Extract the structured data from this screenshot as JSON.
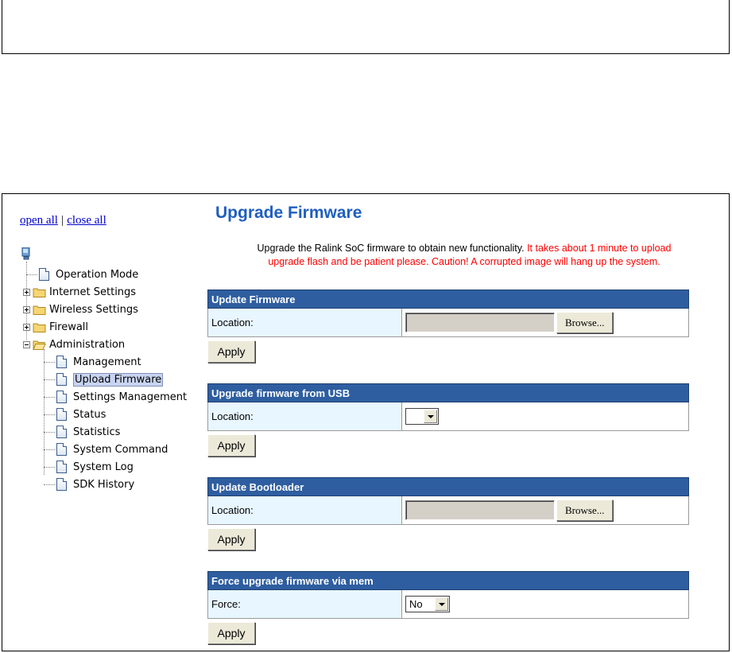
{
  "nav": {
    "open_all": "open all",
    "separator": "|",
    "close_all": "close all",
    "items": [
      {
        "label": "Operation Mode",
        "type": "doc"
      },
      {
        "label": "Internet Settings",
        "type": "folder"
      },
      {
        "label": "Wireless Settings",
        "type": "folder"
      },
      {
        "label": "Firewall",
        "type": "folder"
      },
      {
        "label": "Administration",
        "type": "folder-open"
      }
    ],
    "admin_children": [
      {
        "label": "Management"
      },
      {
        "label": "Upload Firmware",
        "selected": true
      },
      {
        "label": "Settings Management"
      },
      {
        "label": "Status"
      },
      {
        "label": "Statistics"
      },
      {
        "label": "System Command"
      },
      {
        "label": "System Log"
      },
      {
        "label": "SDK History"
      }
    ]
  },
  "page": {
    "title": "Upgrade Firmware",
    "intro_normal": "Upgrade the Ralink SoC firmware to obtain new functionality.",
    "intro_warning_1": "It takes about 1 minute to upload",
    "intro_warning_2": "upgrade flash and be patient please. Caution! A corrupted image will hang up the system."
  },
  "sections": [
    {
      "header": "Update Firmware",
      "label": "Location:",
      "field": "file",
      "browse": "Browse...",
      "apply": "Apply"
    },
    {
      "header": "Upgrade firmware from USB",
      "label": "Location:",
      "field": "select",
      "select_value": "",
      "apply": "Apply"
    },
    {
      "header": "Update Bootloader",
      "label": "Location:",
      "field": "file",
      "browse": "Browse...",
      "apply": "Apply"
    },
    {
      "header": "Force upgrade firmware via mem",
      "label": "Force:",
      "field": "select",
      "select_value": "No",
      "apply": "Apply"
    }
  ],
  "colors": {
    "section_header": "#2e5ea0",
    "label_bg": "#e8f6ff",
    "title": "#1f5fbf",
    "warning": "#ff0000",
    "link": "#0000cc"
  }
}
